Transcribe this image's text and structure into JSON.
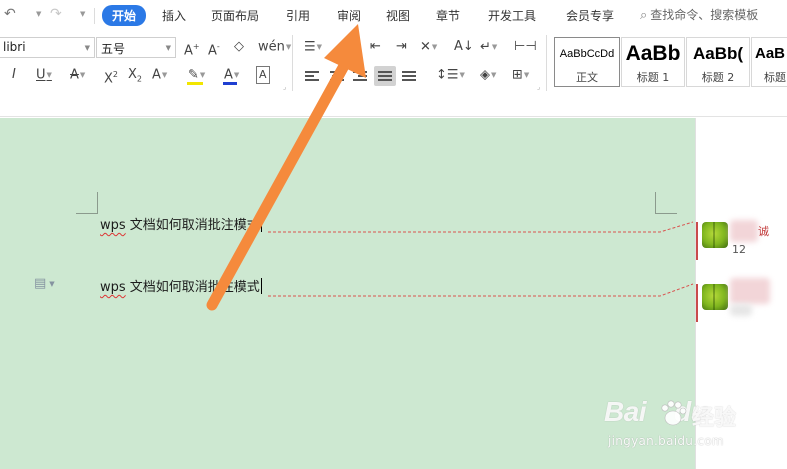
{
  "menubar": {
    "tabs": [
      {
        "label": "开始",
        "active": true
      },
      {
        "label": "插入"
      },
      {
        "label": "页面布局"
      },
      {
        "label": "引用"
      },
      {
        "label": "审阅"
      },
      {
        "label": "视图"
      },
      {
        "label": "章节"
      },
      {
        "label": "开发工具"
      },
      {
        "label": "会员专享"
      }
    ],
    "search_placeholder": "查找命令、搜索模板",
    "quick_access_icons": [
      "undo-icon",
      "redo-icon"
    ]
  },
  "ribbon": {
    "font_name": "libri",
    "font_size": "五号",
    "styles": [
      {
        "sample": "AaBbCcDd",
        "name": "正文"
      },
      {
        "sample": "AaBb",
        "name": "标题 1"
      },
      {
        "sample": "AaBb(",
        "name": "标题 2"
      },
      {
        "sample": "AaB",
        "name": "标题"
      }
    ],
    "highlight_color": "#f2e600",
    "font_color": "#1f3fd1"
  },
  "document": {
    "lines": [
      {
        "prefix": "wps",
        "text": " 文档如何取消批注模式"
      },
      {
        "prefix": "wps",
        "text": " 文档如何取消批注模式"
      }
    ]
  },
  "comments": [
    {
      "author_fragment": "诚",
      "number": "12"
    },
    {
      "author_fragment": "",
      "number": ""
    }
  ],
  "watermark": {
    "brand": "Bai",
    "brand_suffix": "du",
    "cn": "经验",
    "url": "jingyan.baidu.com"
  },
  "colors": {
    "accent": "#2b79e6",
    "document_bg": "#cde8d1",
    "arrow": "#f58a3c",
    "comment_line": "#d9534f"
  }
}
